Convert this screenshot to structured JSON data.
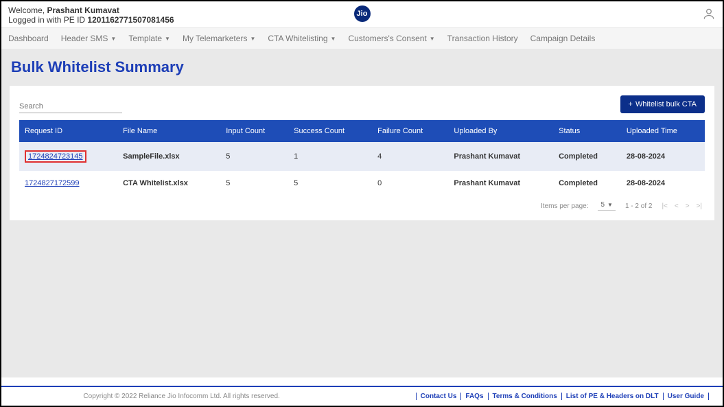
{
  "header": {
    "welcome_prefix": "Welcome, ",
    "username": "Prashant Kumavat",
    "peid_prefix": "Logged in with PE ID ",
    "peid": "1201162771507081456",
    "logo_text": "Jio"
  },
  "nav": {
    "items": [
      {
        "label": "Dashboard",
        "dropdown": false
      },
      {
        "label": "Header SMS",
        "dropdown": true
      },
      {
        "label": "Template",
        "dropdown": true
      },
      {
        "label": "My Telemarketers",
        "dropdown": true
      },
      {
        "label": "CTA Whitelisting",
        "dropdown": true
      },
      {
        "label": "Customers's Consent",
        "dropdown": true
      },
      {
        "label": "Transaction History",
        "dropdown": false
      },
      {
        "label": "Campaign Details",
        "dropdown": false
      }
    ]
  },
  "page": {
    "title": "Bulk Whitelist Summary",
    "search_placeholder": "Search",
    "bulk_button": "Whitelist bulk CTA"
  },
  "table": {
    "headers": [
      "Request ID",
      "File Name",
      "Input Count",
      "Success Count",
      "Failure Count",
      "Uploaded By",
      "Status",
      "Uploaded Time"
    ],
    "rows": [
      {
        "request_id": "1724824723145",
        "file_name": "SampleFile.xlsx",
        "input_count": "5",
        "success_count": "1",
        "failure_count": "4",
        "uploaded_by": "Prashant Kumavat",
        "status": "Completed",
        "uploaded_time": "28-08-2024",
        "highlighted": true
      },
      {
        "request_id": "1724827172599",
        "file_name": "CTA Whitelist.xlsx",
        "input_count": "5",
        "success_count": "5",
        "failure_count": "0",
        "uploaded_by": "Prashant Kumavat",
        "status": "Completed",
        "uploaded_time": "28-08-2024",
        "highlighted": false
      }
    ]
  },
  "pagination": {
    "items_per_page_label": "Items per page:",
    "items_per_page_value": "5",
    "range": "1 - 2 of 2"
  },
  "footer": {
    "copyright": "Copyright © 2022 Reliance Jio Infocomm Ltd. All rights reserved.",
    "links": [
      "Contact Us",
      "FAQs",
      "Terms & Conditions",
      "List of PE & Headers on DLT",
      "User Guide"
    ]
  }
}
